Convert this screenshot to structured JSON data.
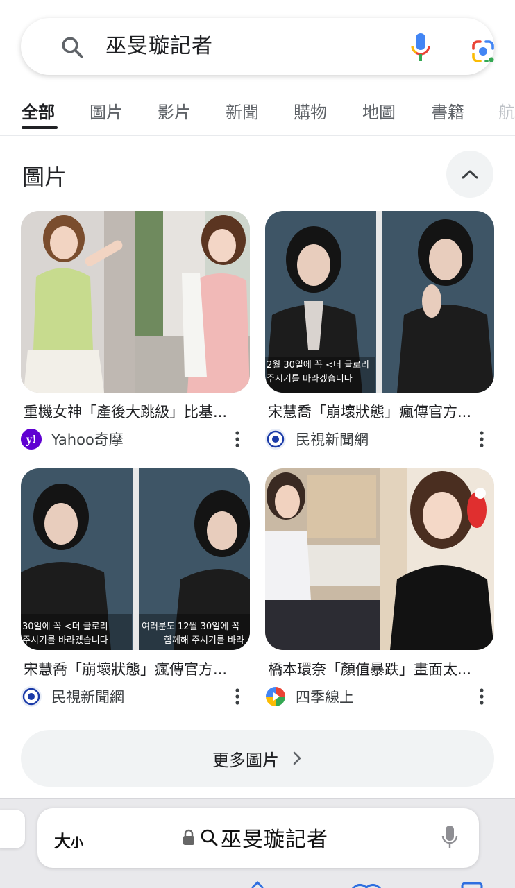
{
  "search": {
    "query": "巫旻璇記者"
  },
  "tabs": [
    {
      "label": "全部",
      "active": true
    },
    {
      "label": "圖片"
    },
    {
      "label": "影片"
    },
    {
      "label": "新聞"
    },
    {
      "label": "購物"
    },
    {
      "label": "地圖"
    },
    {
      "label": "書籍"
    },
    {
      "label": "航"
    }
  ],
  "images_section": {
    "title": "圖片",
    "cards": [
      {
        "title": "重機女神「產後大跳級」比基...",
        "source": "Yahoo奇摩",
        "source_icon": "yahoo-icon",
        "overlay_left": "",
        "overlay_right": ""
      },
      {
        "title": "宋慧喬「崩壞狀態」瘋傳官方...",
        "source": "民視新聞網",
        "source_icon": "ftv-icon",
        "overlay_left": "2월 30일에 꼭 <더 글로리",
        "overlay_left2": "주시기를 바라겠습니다"
      },
      {
        "title": "宋慧喬「崩壞狀態」瘋傳官方...",
        "source": "民視新聞網",
        "source_icon": "ftv-icon",
        "overlay_left": "30일에 꼭 <더 글로리",
        "overlay_left2": "주시기를 바라겠습니다",
        "overlay_right": "여러분도 12월 30일에 꼭",
        "overlay_right2": "함께해 주시기를 바라"
      },
      {
        "title": "橋本環奈「顏值暴跌」畫面太...",
        "source": "四季線上",
        "source_icon": "4gtv-icon"
      }
    ],
    "more_label": "更多圖片"
  },
  "browser": {
    "text_size_label": "大",
    "text_size_small": "小",
    "address": "巫旻璇記者"
  },
  "colors": {
    "google_blue": "#4285F4",
    "google_red": "#EA4335",
    "google_yellow": "#FBBC05",
    "google_green": "#34A853",
    "yahoo_purple": "#6001D2",
    "ftv_blue": "#1a3aa8"
  }
}
